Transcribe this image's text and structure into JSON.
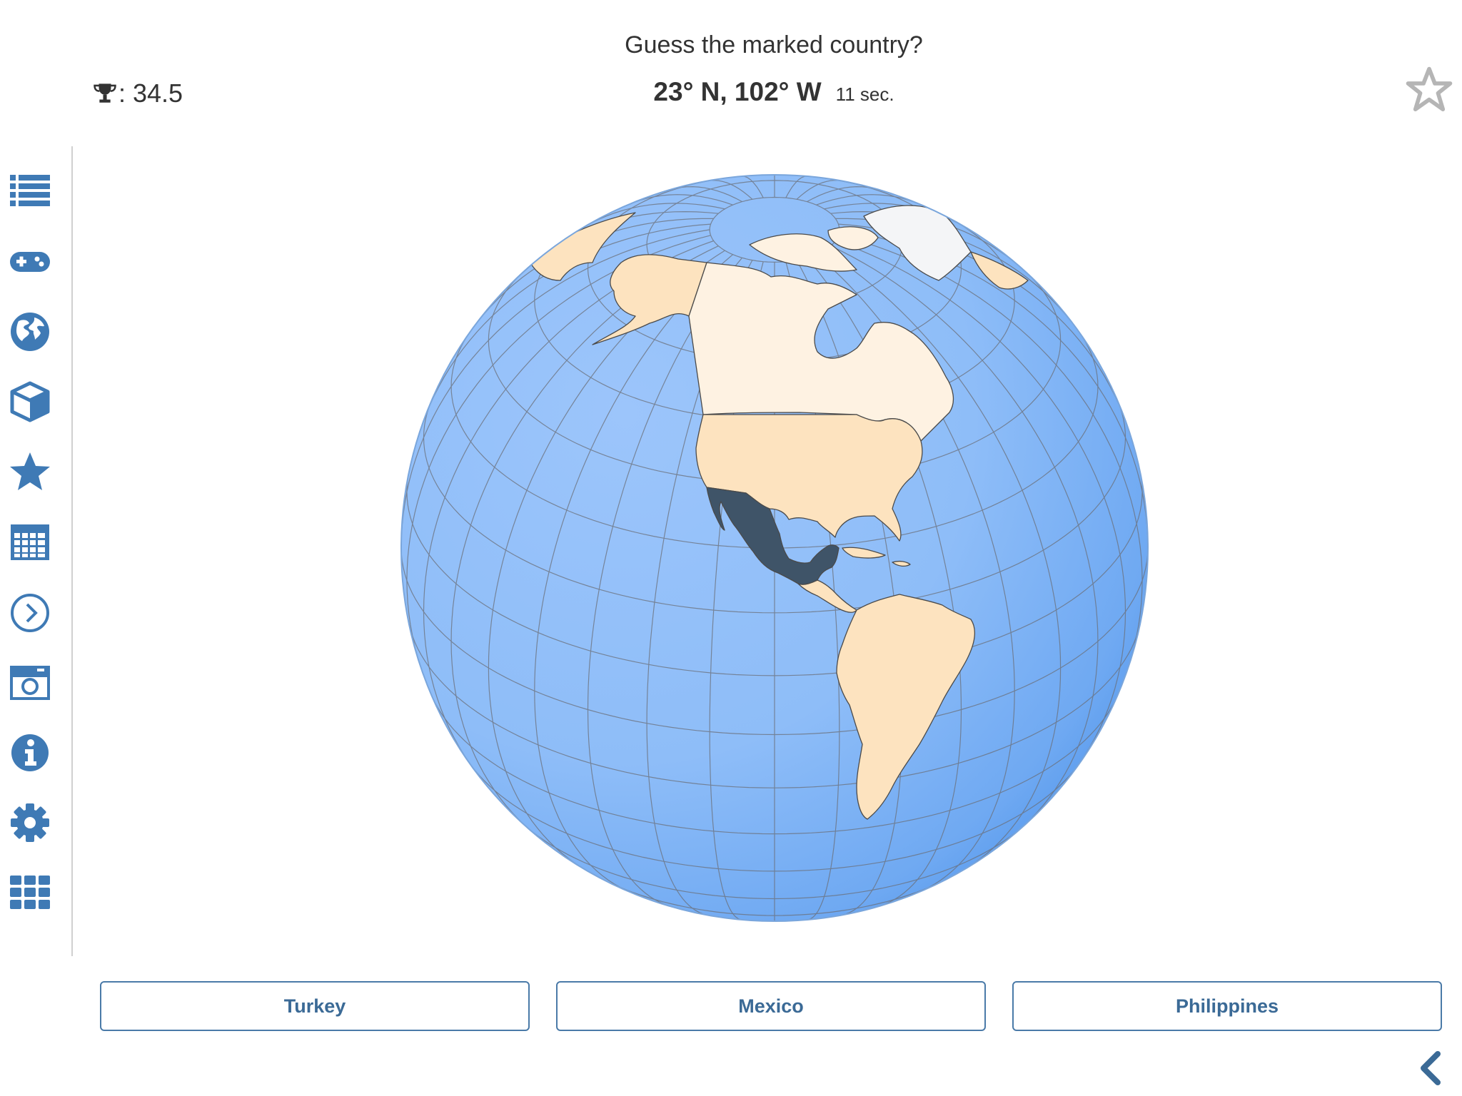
{
  "header": {
    "question": "Guess the marked country?",
    "score_value": ": 34.5",
    "coordinates": "23° N, 102° W",
    "timer": "11 sec."
  },
  "answers": [
    {
      "label": "Turkey"
    },
    {
      "label": "Mexico"
    },
    {
      "label": "Philippines"
    }
  ],
  "sidebar": {
    "items": [
      {
        "icon": "list-icon"
      },
      {
        "icon": "gamepad-icon"
      },
      {
        "icon": "globe-icon"
      },
      {
        "icon": "cube-icon"
      },
      {
        "icon": "star-icon"
      },
      {
        "icon": "calendar-icon"
      },
      {
        "icon": "chevron-circle-icon"
      },
      {
        "icon": "camera-icon"
      },
      {
        "icon": "info-icon"
      },
      {
        "icon": "gear-icon"
      },
      {
        "icon": "grid-icon"
      }
    ]
  },
  "map": {
    "highlighted_country_color": "#3f5468",
    "land_color": "#fde5c5",
    "ocean_color": "#8fbcf5"
  },
  "colors": {
    "accent": "#3b6a96",
    "icon": "#3f7ab5"
  }
}
